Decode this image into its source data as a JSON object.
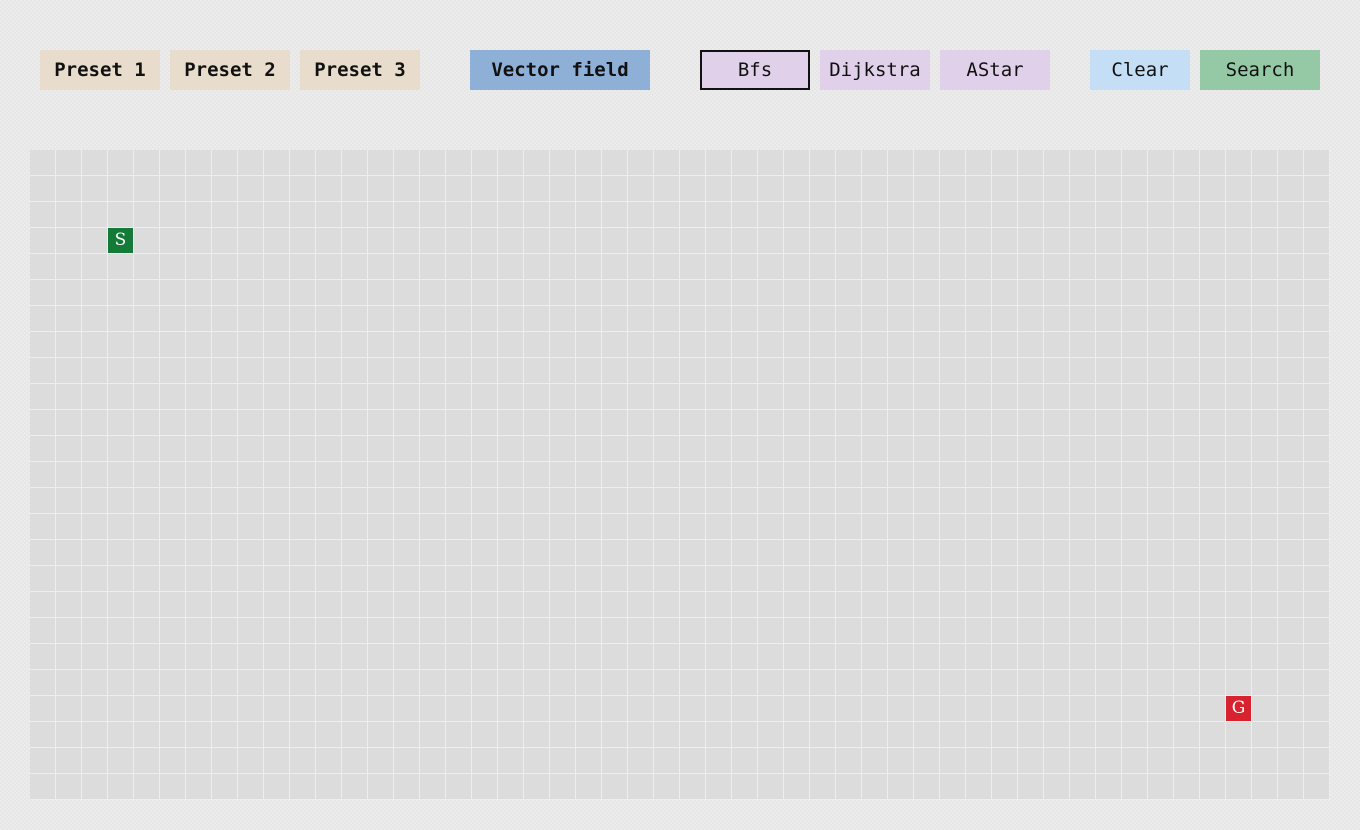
{
  "toolbar": {
    "presets": [
      {
        "label": "Preset 1",
        "color": "#e8dccc"
      },
      {
        "label": "Preset 2",
        "color": "#e8dccc"
      },
      {
        "label": "Preset 3",
        "color": "#e8dccc"
      }
    ],
    "vector_field": {
      "label": "Vector field",
      "color": "#8fb0d6"
    },
    "algorithms": [
      {
        "label": "Bfs",
        "color": "#e0d0ea",
        "selected": true
      },
      {
        "label": "Dijkstra",
        "color": "#e0d0ea",
        "selected": false
      },
      {
        "label": "AStar",
        "color": "#e0d0ea",
        "selected": false
      }
    ],
    "clear": {
      "label": "Clear",
      "color": "#c4dff5"
    },
    "search": {
      "label": "Search",
      "color": "#95c9a6"
    }
  },
  "grid": {
    "columns": 50,
    "rows": 25,
    "background": "#dcdcdc",
    "line_color": "#eeeeee"
  },
  "start": {
    "label": "S",
    "col": 3,
    "row": 3,
    "color": "#137a38"
  },
  "goal": {
    "label": "G",
    "col": 46,
    "row": 21,
    "color": "#d7232f"
  }
}
